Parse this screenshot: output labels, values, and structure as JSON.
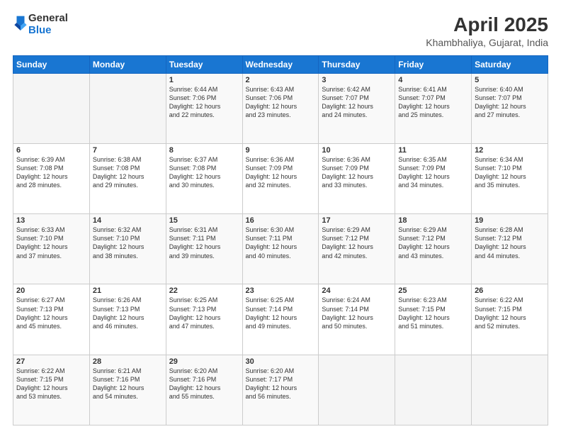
{
  "logo": {
    "line1": "General",
    "line2": "Blue"
  },
  "title": "April 2025",
  "subtitle": "Khambhaliya, Gujarat, India",
  "weekdays": [
    "Sunday",
    "Monday",
    "Tuesday",
    "Wednesday",
    "Thursday",
    "Friday",
    "Saturday"
  ],
  "weeks": [
    [
      {
        "num": "",
        "detail": ""
      },
      {
        "num": "",
        "detail": ""
      },
      {
        "num": "1",
        "detail": "Sunrise: 6:44 AM\nSunset: 7:06 PM\nDaylight: 12 hours\nand 22 minutes."
      },
      {
        "num": "2",
        "detail": "Sunrise: 6:43 AM\nSunset: 7:06 PM\nDaylight: 12 hours\nand 23 minutes."
      },
      {
        "num": "3",
        "detail": "Sunrise: 6:42 AM\nSunset: 7:07 PM\nDaylight: 12 hours\nand 24 minutes."
      },
      {
        "num": "4",
        "detail": "Sunrise: 6:41 AM\nSunset: 7:07 PM\nDaylight: 12 hours\nand 25 minutes."
      },
      {
        "num": "5",
        "detail": "Sunrise: 6:40 AM\nSunset: 7:07 PM\nDaylight: 12 hours\nand 27 minutes."
      }
    ],
    [
      {
        "num": "6",
        "detail": "Sunrise: 6:39 AM\nSunset: 7:08 PM\nDaylight: 12 hours\nand 28 minutes."
      },
      {
        "num": "7",
        "detail": "Sunrise: 6:38 AM\nSunset: 7:08 PM\nDaylight: 12 hours\nand 29 minutes."
      },
      {
        "num": "8",
        "detail": "Sunrise: 6:37 AM\nSunset: 7:08 PM\nDaylight: 12 hours\nand 30 minutes."
      },
      {
        "num": "9",
        "detail": "Sunrise: 6:36 AM\nSunset: 7:09 PM\nDaylight: 12 hours\nand 32 minutes."
      },
      {
        "num": "10",
        "detail": "Sunrise: 6:36 AM\nSunset: 7:09 PM\nDaylight: 12 hours\nand 33 minutes."
      },
      {
        "num": "11",
        "detail": "Sunrise: 6:35 AM\nSunset: 7:09 PM\nDaylight: 12 hours\nand 34 minutes."
      },
      {
        "num": "12",
        "detail": "Sunrise: 6:34 AM\nSunset: 7:10 PM\nDaylight: 12 hours\nand 35 minutes."
      }
    ],
    [
      {
        "num": "13",
        "detail": "Sunrise: 6:33 AM\nSunset: 7:10 PM\nDaylight: 12 hours\nand 37 minutes."
      },
      {
        "num": "14",
        "detail": "Sunrise: 6:32 AM\nSunset: 7:10 PM\nDaylight: 12 hours\nand 38 minutes."
      },
      {
        "num": "15",
        "detail": "Sunrise: 6:31 AM\nSunset: 7:11 PM\nDaylight: 12 hours\nand 39 minutes."
      },
      {
        "num": "16",
        "detail": "Sunrise: 6:30 AM\nSunset: 7:11 PM\nDaylight: 12 hours\nand 40 minutes."
      },
      {
        "num": "17",
        "detail": "Sunrise: 6:29 AM\nSunset: 7:12 PM\nDaylight: 12 hours\nand 42 minutes."
      },
      {
        "num": "18",
        "detail": "Sunrise: 6:29 AM\nSunset: 7:12 PM\nDaylight: 12 hours\nand 43 minutes."
      },
      {
        "num": "19",
        "detail": "Sunrise: 6:28 AM\nSunset: 7:12 PM\nDaylight: 12 hours\nand 44 minutes."
      }
    ],
    [
      {
        "num": "20",
        "detail": "Sunrise: 6:27 AM\nSunset: 7:13 PM\nDaylight: 12 hours\nand 45 minutes."
      },
      {
        "num": "21",
        "detail": "Sunrise: 6:26 AM\nSunset: 7:13 PM\nDaylight: 12 hours\nand 46 minutes."
      },
      {
        "num": "22",
        "detail": "Sunrise: 6:25 AM\nSunset: 7:13 PM\nDaylight: 12 hours\nand 47 minutes."
      },
      {
        "num": "23",
        "detail": "Sunrise: 6:25 AM\nSunset: 7:14 PM\nDaylight: 12 hours\nand 49 minutes."
      },
      {
        "num": "24",
        "detail": "Sunrise: 6:24 AM\nSunset: 7:14 PM\nDaylight: 12 hours\nand 50 minutes."
      },
      {
        "num": "25",
        "detail": "Sunrise: 6:23 AM\nSunset: 7:15 PM\nDaylight: 12 hours\nand 51 minutes."
      },
      {
        "num": "26",
        "detail": "Sunrise: 6:22 AM\nSunset: 7:15 PM\nDaylight: 12 hours\nand 52 minutes."
      }
    ],
    [
      {
        "num": "27",
        "detail": "Sunrise: 6:22 AM\nSunset: 7:15 PM\nDaylight: 12 hours\nand 53 minutes."
      },
      {
        "num": "28",
        "detail": "Sunrise: 6:21 AM\nSunset: 7:16 PM\nDaylight: 12 hours\nand 54 minutes."
      },
      {
        "num": "29",
        "detail": "Sunrise: 6:20 AM\nSunset: 7:16 PM\nDaylight: 12 hours\nand 55 minutes."
      },
      {
        "num": "30",
        "detail": "Sunrise: 6:20 AM\nSunset: 7:17 PM\nDaylight: 12 hours\nand 56 minutes."
      },
      {
        "num": "",
        "detail": ""
      },
      {
        "num": "",
        "detail": ""
      },
      {
        "num": "",
        "detail": ""
      }
    ]
  ]
}
